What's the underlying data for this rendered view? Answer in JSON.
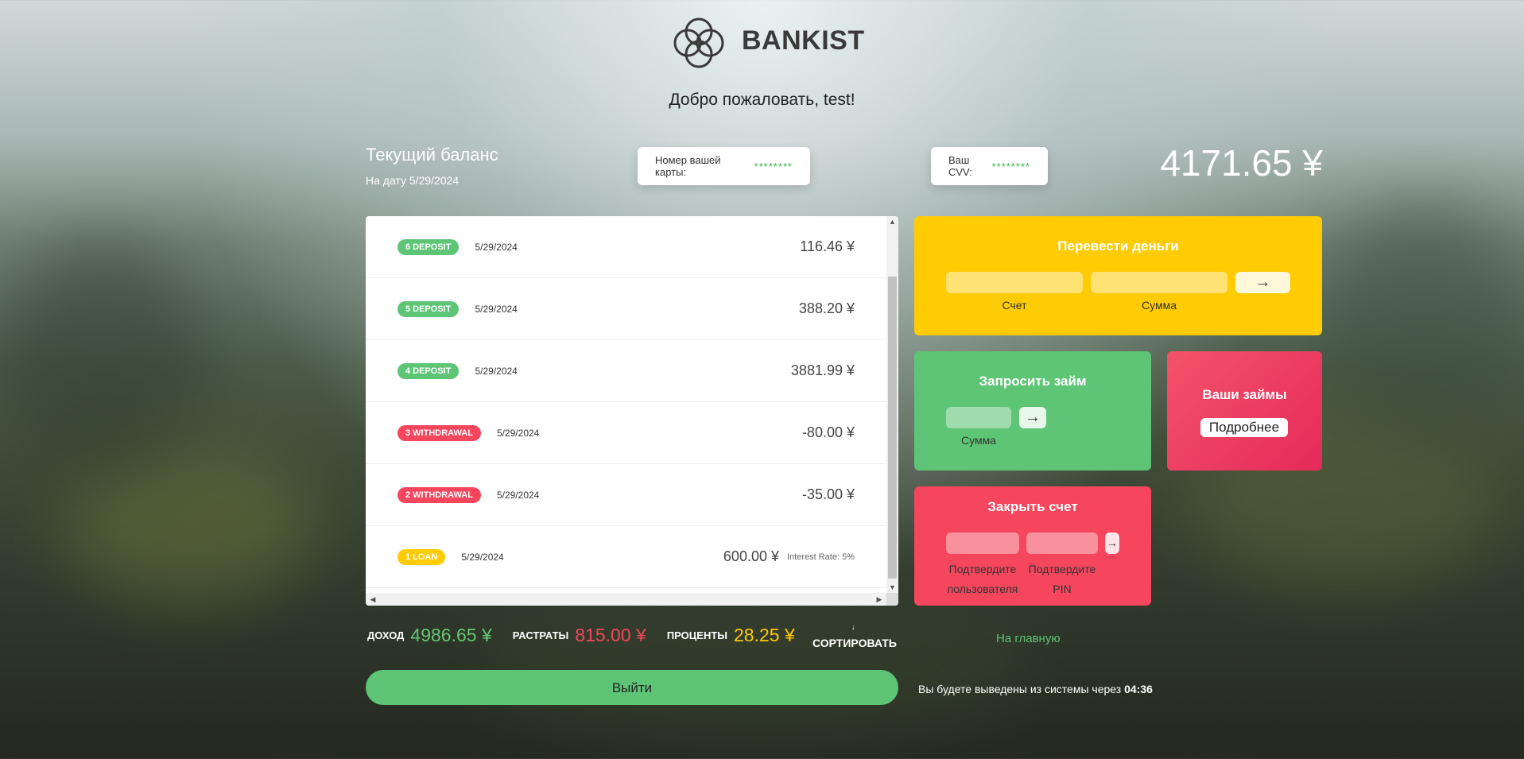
{
  "brand": "BANKIST",
  "welcome": "Добро пожаловать, test!",
  "balance": {
    "label": "Текущий баланс",
    "date": "На дату 5/29/2024",
    "value": "4171.65 ¥",
    "card_label": "Номер вашей карты:",
    "card_value": "********",
    "cvv_label": "Ваш CVV:",
    "cvv_value": "********"
  },
  "movements": [
    {
      "type": "6 DEPOSIT",
      "kind": "deposit",
      "date": "5/29/2024",
      "value": "116.46 ¥",
      "rate": ""
    },
    {
      "type": "5 DEPOSIT",
      "kind": "deposit",
      "date": "5/29/2024",
      "value": "388.20 ¥",
      "rate": ""
    },
    {
      "type": "4 DEPOSIT",
      "kind": "deposit",
      "date": "5/29/2024",
      "value": "3881.99 ¥",
      "rate": ""
    },
    {
      "type": "3 WITHDRAWAL",
      "kind": "withdrawal",
      "date": "5/29/2024",
      "value": "-80.00 ¥",
      "rate": ""
    },
    {
      "type": "2 WITHDRAWAL",
      "kind": "withdrawal",
      "date": "5/29/2024",
      "value": "-35.00 ¥",
      "rate": ""
    },
    {
      "type": "1 LOAN",
      "kind": "loan",
      "date": "5/29/2024",
      "value": "600.00 ¥",
      "rate": "Interest Rate: 5%"
    }
  ],
  "transfer": {
    "title": "Перевести деньги",
    "account_label": "Счет",
    "amount_label": "Сумма",
    "submit": "→"
  },
  "loan": {
    "title": "Запросить займ",
    "amount_label": "Сумма",
    "submit": "→"
  },
  "my_loans": {
    "title": "Ваши займы",
    "details": "Подробнее"
  },
  "close": {
    "title": "Закрыть счет",
    "user_label_1": "Подтвердите",
    "user_label_2": "пользователя",
    "pin_label_1": "Подтвердите",
    "pin_label_2": "PIN",
    "submit": "→"
  },
  "summary": {
    "in_label": "ДОХОД",
    "in_value": "4986.65 ¥",
    "out_label": "РАСТРАТЫ",
    "out_value": "815.00 ¥",
    "interest_label": "ПРОЦЕНТЫ",
    "interest_value": "28.25 ¥",
    "sort_arrow": "↓",
    "sort_label": "СОРТИРОВАТЬ"
  },
  "home_link": "На главную",
  "logout": "Выйти",
  "timer": {
    "text": "Вы будете выведены из системы через",
    "value": "04:36"
  },
  "colors": {
    "deposit": "#5ec576",
    "withdrawal": "#f5465d",
    "loan": "#ffcb03"
  }
}
